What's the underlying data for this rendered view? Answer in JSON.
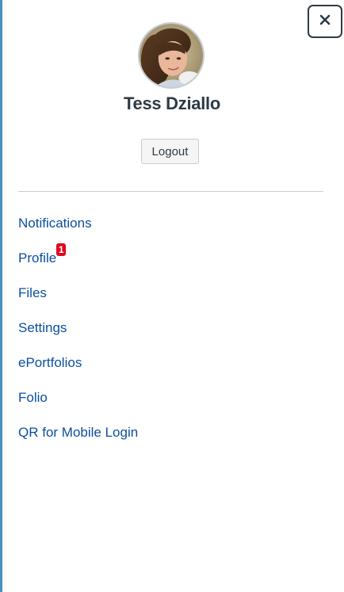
{
  "tray": {
    "close_icon": "close-icon",
    "user": {
      "name": "Tess Dziallo",
      "avatar_icon": "user-avatar-photo"
    },
    "logout_label": "Logout",
    "menu": [
      {
        "label": "Notifications"
      },
      {
        "label": "Profile",
        "badge": "1"
      },
      {
        "label": "Files"
      },
      {
        "label": "Settings"
      },
      {
        "label": "ePortfolios"
      },
      {
        "label": "Folio"
      },
      {
        "label": "QR for Mobile Login"
      }
    ]
  },
  "colors": {
    "link": "#0b4fa0",
    "badge": "#e0061f",
    "text": "#2d3b45",
    "page_edge": "#4a90b8"
  }
}
